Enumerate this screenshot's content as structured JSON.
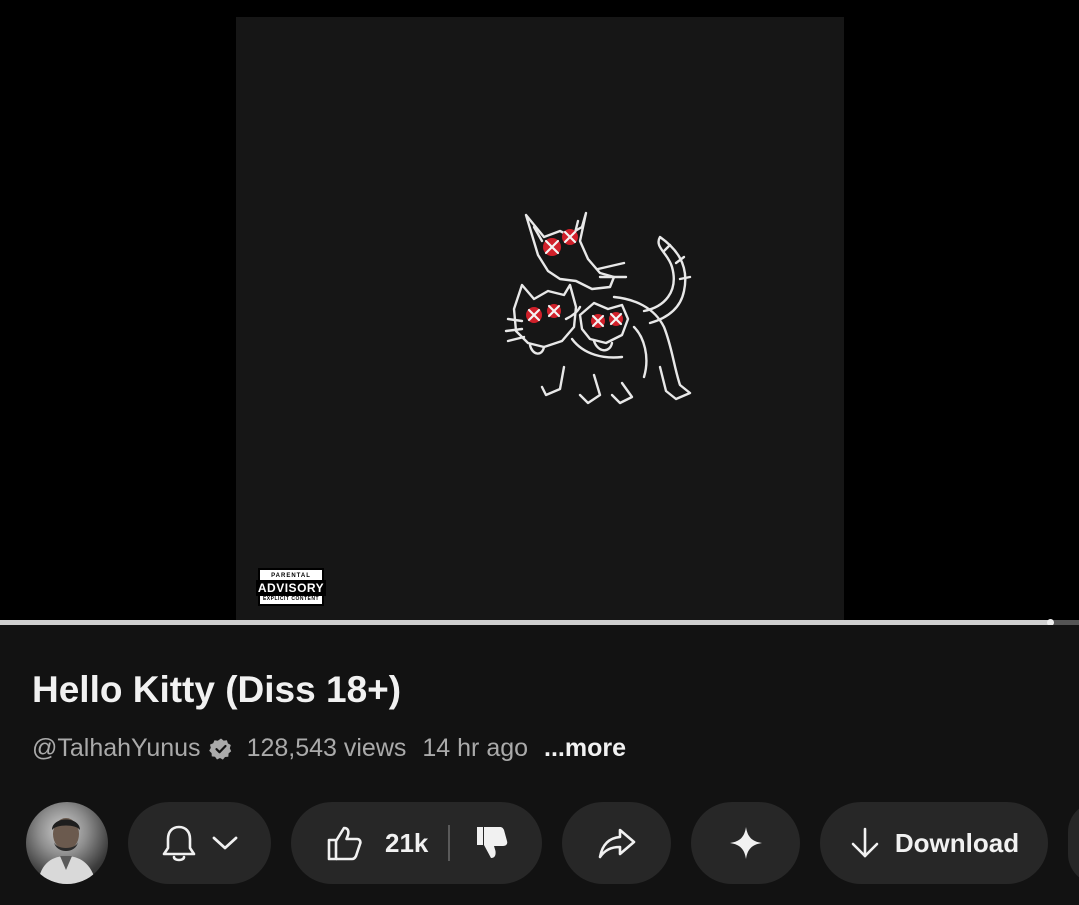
{
  "video": {
    "title": "Hello Kitty (Diss 18+)",
    "progress_fraction": 0.973,
    "cover": {
      "advisory_line1": "PARENTAL",
      "advisory_line2": "ADVISORY",
      "advisory_line3": "EXPLICIT CONTENT"
    }
  },
  "channel": {
    "handle": "@TalhahYunus",
    "verified_icon": "verified-badge-icon"
  },
  "meta": {
    "views": "128,543 views",
    "uploaded": "14 hr ago",
    "more_label": "...more"
  },
  "actions": {
    "subscribe_icon": "bell-icon",
    "like_count": "21k",
    "share_icon": "share-icon",
    "ai_icon": "sparkle-icon",
    "download_label": "Download"
  },
  "colors": {
    "background": "#0f0f0f",
    "pill": "#272727",
    "secondary_text": "#aaaaaa",
    "accent_red": "#d0202a"
  }
}
